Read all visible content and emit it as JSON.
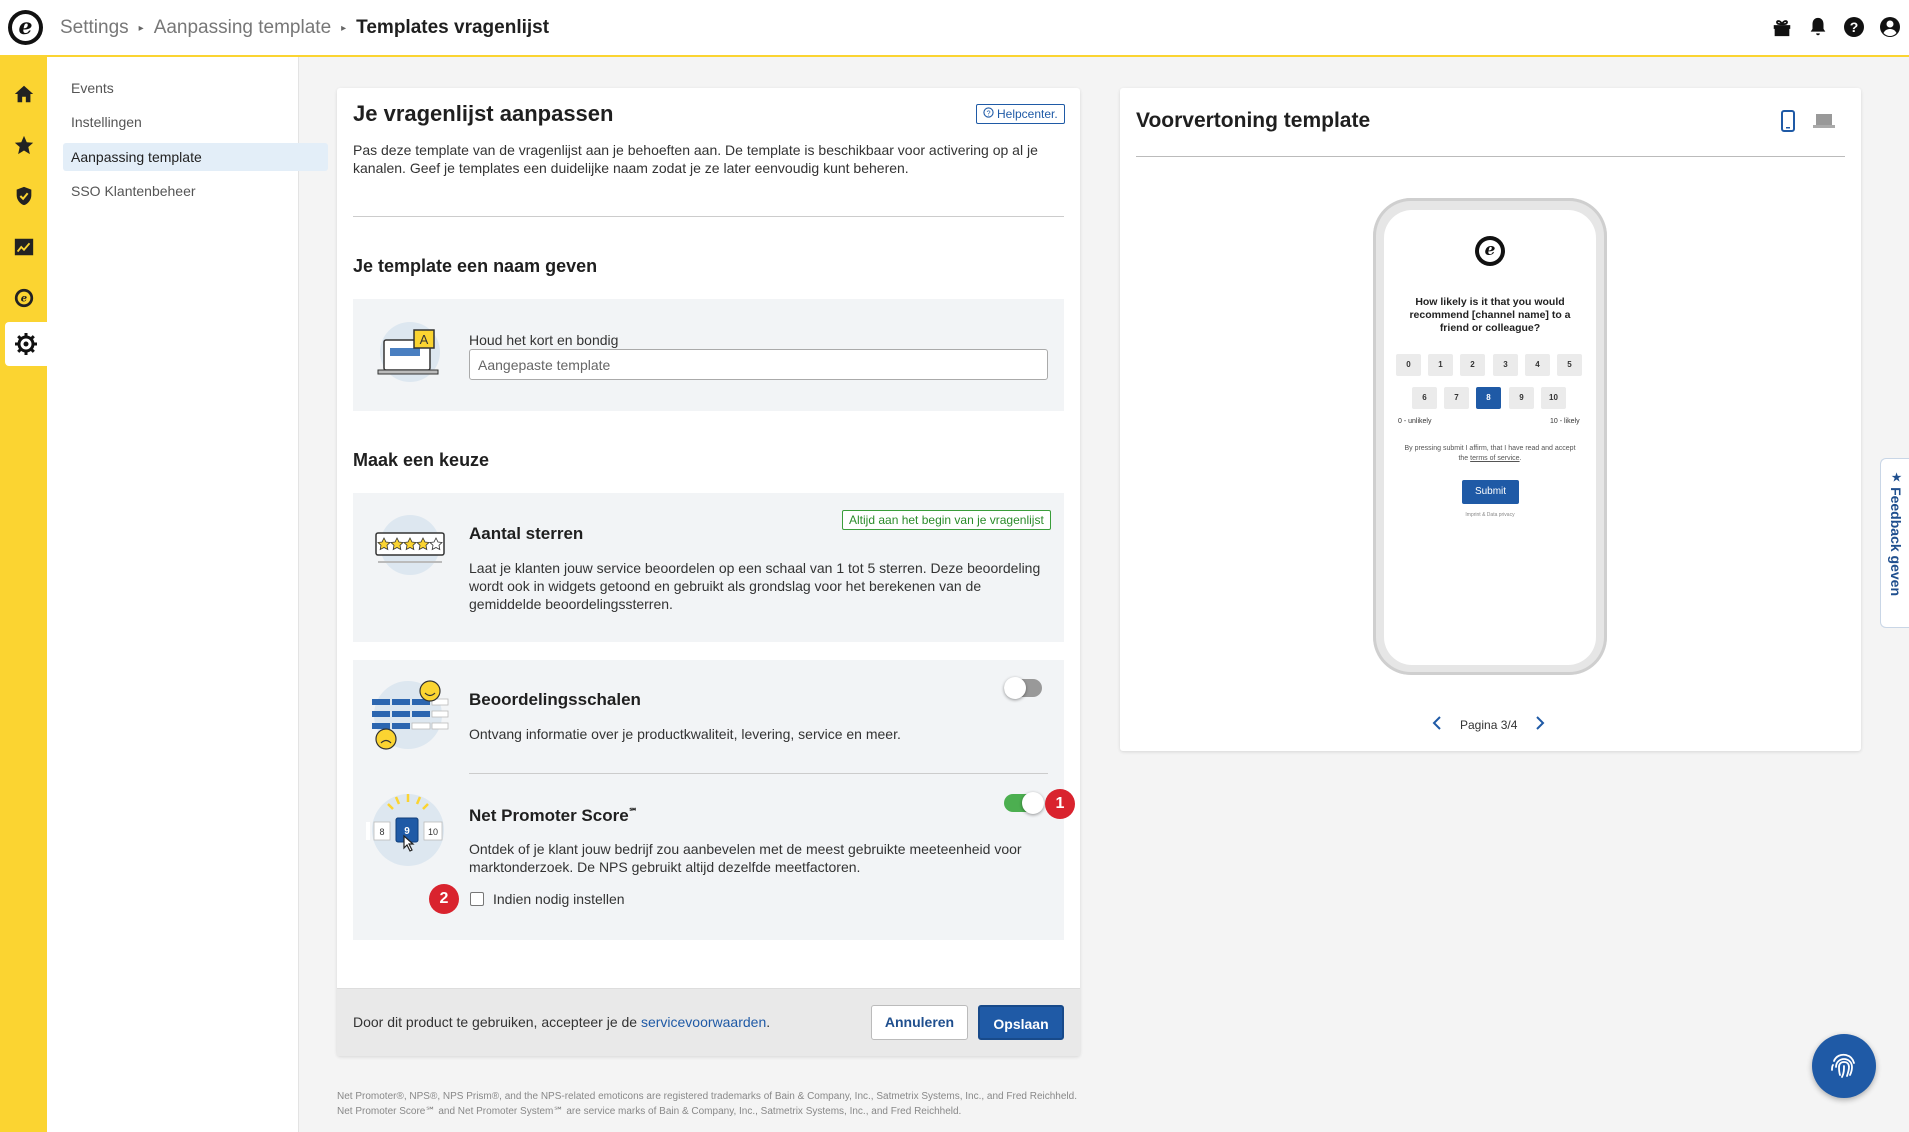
{
  "breadcrumb": {
    "items": [
      "Settings",
      "Aanpassing template"
    ],
    "current": "Templates vragenlijst"
  },
  "topbar_icons": [
    "gift-icon",
    "bell-icon",
    "help-icon",
    "user-icon"
  ],
  "rail_icons": [
    "home-icon",
    "star-icon",
    "shield-icon",
    "chart-icon",
    "trustedshops-icon",
    "gear-icon"
  ],
  "subnav": {
    "items": [
      {
        "label": "Events"
      },
      {
        "label": "Instellingen"
      },
      {
        "label": "Aanpassing template"
      },
      {
        "label": "SSO Klantenbeheer"
      }
    ],
    "active_index": 2
  },
  "editor": {
    "title": "Je vragenlijst aanpassen",
    "helpcenter_label": "Helpcenter.",
    "description": "Pas deze template van de vragenlijst aan je behoeften aan. De template is beschikbaar voor activering op al je kanalen. Geef je templates een duidelijke naam zodat je ze later eenvoudig kunt beheren.",
    "name_section": {
      "heading": "Je template een naam geven",
      "field_label": "Houd het kort en bondig",
      "placeholder": "Aangepaste template",
      "value": ""
    },
    "choice_section": {
      "heading": "Maak een keuze",
      "stars": {
        "title": "Aantal sterren",
        "badge": "Altijd aan het begin van je vragenlijst",
        "description": "Laat je klanten jouw service beoordelen op een schaal van 1 tot 5 sterren. Deze beoordeling wordt ook in widgets getoond en gebruikt als grondslag voor het berekenen van de gemiddelde beoordelingssterren."
      },
      "rating_scales": {
        "title": "Beoordelingsschalen",
        "description": "Ontvang informatie over je productkwaliteit, levering, service en meer.",
        "enabled": false
      },
      "nps": {
        "title": "Net Promoter Score",
        "title_mark": "℠",
        "description": "Ontdek of je klant jouw bedrijf zou aanbevelen met de meest gebruikte meeteenheid voor marktonderzoek. De NPS gebruikt altijd dezelfde meetfactoren.",
        "enabled": true,
        "checkbox_label": "Indien nodig instellen",
        "checkbox_checked": false,
        "illus_numbers": [
          "8",
          "9",
          "10"
        ]
      }
    },
    "annotations": [
      "1",
      "2"
    ],
    "footer": {
      "text": "Door dit product te gebruiken, accepteer je de",
      "link": "servicevoorwaarden",
      "after_link": ".",
      "cancel_label": "Annuleren",
      "save_label": "Opslaan"
    },
    "fine_print": "Net Promoter®, NPS®, NPS Prism®, and the NPS-related emoticons are registered trademarks of Bain & Company, Inc., Satmetrix Systems, Inc., and Fred Reichheld. Net Promoter Score℠ and Net Promoter System℠ are service marks of Bain & Company, Inc., Satmetrix Systems, Inc., and Fred Reichheld."
  },
  "preview": {
    "title": "Voorvertoning template",
    "device_icons": [
      "mobile-icon",
      "desktop-icon"
    ],
    "active_device": "mobile",
    "phone": {
      "question": "How likely is it that you would recommend [channel name] to a friend or colleague?",
      "row1": [
        "0",
        "1",
        "2",
        "3",
        "4",
        "5"
      ],
      "row2": [
        "6",
        "7",
        "8",
        "9",
        "10"
      ],
      "selected": "8",
      "low_label": "0 - unlikely",
      "high_label": "10 - likely",
      "consent": "By pressing submit I affirm, that I have read and accept the",
      "consent_link": "terms of service",
      "consent_end": ".",
      "submit_label": "Submit",
      "footer_links": "Imprint & Data privacy"
    },
    "pager": "Pagina 3/4"
  },
  "feedback_tab": "Feedback geven",
  "colors": {
    "brand_yellow": "#fbd431",
    "primary_blue": "#1f5aa6",
    "toggle_on": "#4caf50",
    "badge_red": "#d9232e"
  }
}
